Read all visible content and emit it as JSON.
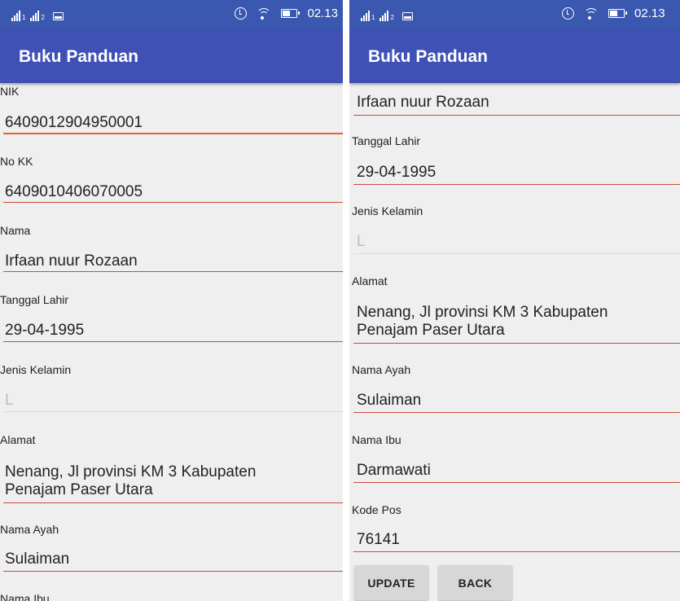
{
  "status_bar": {
    "time": "02.13",
    "sim1": "1",
    "sim2": "2"
  },
  "app_bar": {
    "title": "Buku Panduan"
  },
  "fields": {
    "nik": {
      "label": "NIK",
      "value": "6409012904950001"
    },
    "no_kk": {
      "label": "No KK",
      "value": "6409010406070005"
    },
    "nama": {
      "label": "Nama",
      "value": "Irfaan nuur Rozaan"
    },
    "tanggal_lahir": {
      "label": "Tanggal Lahir",
      "value": "29-04-1995"
    },
    "jenis_kelamin": {
      "label": "Jenis Kelamin",
      "value": "L"
    },
    "alamat": {
      "label": "Alamat",
      "line1": "Nenang, Jl provinsi KM 3 Kabupaten",
      "line2": "Penajam Paser Utara"
    },
    "nama_ayah": {
      "label": "Nama Ayah",
      "value": "Sulaiman"
    },
    "nama_ibu": {
      "label": "Nama Ibu",
      "value": "Darmawati"
    },
    "kode_pos": {
      "label": "Kode Pos",
      "value": "76141"
    }
  },
  "buttons": {
    "update": "UPDATE",
    "back": "BACK"
  },
  "colors": {
    "status_bar": "#3b58b1",
    "app_bar": "#3f51b5",
    "background": "#efefef",
    "underline": "#cc4c3a",
    "underline_focused": "#e76033",
    "button": "#d7d7d7"
  }
}
